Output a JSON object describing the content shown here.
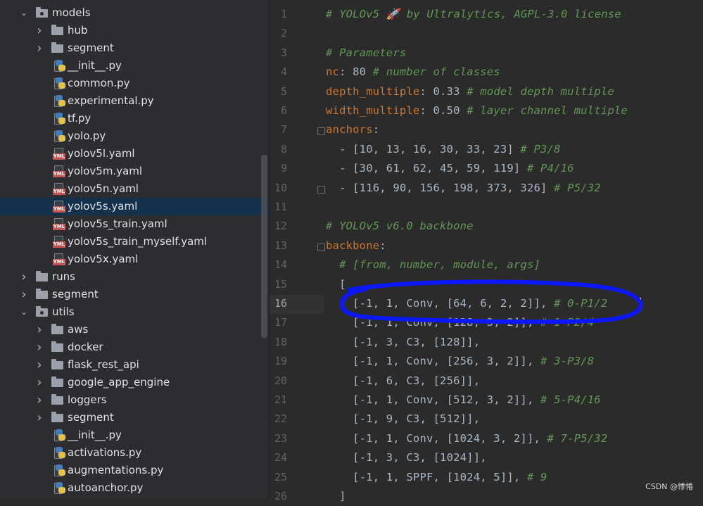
{
  "tree": {
    "items": [
      {
        "label": "models",
        "type": "folder-open",
        "indent": 0
      },
      {
        "label": "hub",
        "type": "folder",
        "indent": 1
      },
      {
        "label": "segment",
        "type": "folder",
        "indent": 1
      },
      {
        "label": "__init__.py",
        "type": "py",
        "indent": 1
      },
      {
        "label": "common.py",
        "type": "py",
        "indent": 1
      },
      {
        "label": "experimental.py",
        "type": "py",
        "indent": 1
      },
      {
        "label": "tf.py",
        "type": "py",
        "indent": 1
      },
      {
        "label": "yolo.py",
        "type": "py",
        "indent": 1
      },
      {
        "label": "yolov5l.yaml",
        "type": "yml",
        "indent": 1
      },
      {
        "label": "yolov5m.yaml",
        "type": "yml",
        "indent": 1
      },
      {
        "label": "yolov5n.yaml",
        "type": "yml",
        "indent": 1
      },
      {
        "label": "yolov5s.yaml",
        "type": "yml",
        "indent": 1,
        "selected": true
      },
      {
        "label": "yolov5s_train.yaml",
        "type": "yml",
        "indent": 1
      },
      {
        "label": "yolov5s_train_myself.yaml",
        "type": "yml",
        "indent": 1
      },
      {
        "label": "yolov5x.yaml",
        "type": "yml",
        "indent": 1
      },
      {
        "label": "runs",
        "type": "folder",
        "indent": 0
      },
      {
        "label": "segment",
        "type": "folder",
        "indent": 0
      },
      {
        "label": "utils",
        "type": "folder-open",
        "indent": 0
      },
      {
        "label": "aws",
        "type": "folder",
        "indent": 1
      },
      {
        "label": "docker",
        "type": "folder",
        "indent": 1
      },
      {
        "label": "flask_rest_api",
        "type": "folder",
        "indent": 1
      },
      {
        "label": "google_app_engine",
        "type": "folder",
        "indent": 1
      },
      {
        "label": "loggers",
        "type": "folder",
        "indent": 1
      },
      {
        "label": "segment",
        "type": "folder",
        "indent": 1
      },
      {
        "label": "__init__.py",
        "type": "py",
        "indent": 1
      },
      {
        "label": "activations.py",
        "type": "py",
        "indent": 1
      },
      {
        "label": "augmentations.py",
        "type": "py",
        "indent": 1
      },
      {
        "label": "autoanchor.py",
        "type": "py",
        "indent": 1
      }
    ]
  },
  "editor": {
    "current_line": 16,
    "lines": [
      {
        "n": "1",
        "parts": [
          {
            "t": "# YOLOv5 🚀 by Ultralytics, AGPL-3.0 license",
            "c": "cm"
          }
        ]
      },
      {
        "n": "2",
        "parts": []
      },
      {
        "n": "3",
        "parts": [
          {
            "t": "# Parameters",
            "c": "cm"
          }
        ]
      },
      {
        "n": "4",
        "parts": [
          {
            "t": "nc",
            "c": "ky"
          },
          {
            "t": ": 80 ",
            "c": ""
          },
          {
            "t": "# number of classes",
            "c": "cm"
          }
        ]
      },
      {
        "n": "5",
        "parts": [
          {
            "t": "depth_multiple",
            "c": "ky"
          },
          {
            "t": ": 0.33 ",
            "c": ""
          },
          {
            "t": "# model depth multiple",
            "c": "cm"
          }
        ]
      },
      {
        "n": "6",
        "parts": [
          {
            "t": "width_multiple",
            "c": "ky"
          },
          {
            "t": ": 0.50 ",
            "c": ""
          },
          {
            "t": "# layer channel multiple",
            "c": "cm"
          }
        ]
      },
      {
        "n": "7",
        "parts": [
          {
            "t": "anchors",
            "c": "ky"
          },
          {
            "t": ":",
            "c": ""
          }
        ]
      },
      {
        "n": "8",
        "parts": [
          {
            "t": "  - [10, 13, 16, 30, 33, 23] ",
            "c": ""
          },
          {
            "t": "# P3/8",
            "c": "cm"
          }
        ]
      },
      {
        "n": "9",
        "parts": [
          {
            "t": "  - [30, 61, 62, 45, 59, 119] ",
            "c": ""
          },
          {
            "t": "# P4/16",
            "c": "cm"
          }
        ]
      },
      {
        "n": "10",
        "parts": [
          {
            "t": "  - [116, 90, 156, 198, 373, 326] ",
            "c": ""
          },
          {
            "t": "# P5/32",
            "c": "cm"
          }
        ]
      },
      {
        "n": "11",
        "parts": []
      },
      {
        "n": "12",
        "parts": [
          {
            "t": "# YOLOv5 v6.0 backbone",
            "c": "cm"
          }
        ]
      },
      {
        "n": "13",
        "parts": [
          {
            "t": "backbone",
            "c": "ky"
          },
          {
            "t": ":",
            "c": ""
          }
        ]
      },
      {
        "n": "14",
        "parts": [
          {
            "t": "  ",
            "c": ""
          },
          {
            "t": "# [from, number, module, args]",
            "c": "cm"
          }
        ]
      },
      {
        "n": "15",
        "parts": [
          {
            "t": "  [",
            "c": ""
          }
        ]
      },
      {
        "n": "16",
        "parts": [
          {
            "t": "    [-1, 1, Conv, [64, 6, 2, 2]], ",
            "c": ""
          },
          {
            "t": "# 0-P1/2",
            "c": "cm"
          }
        ]
      },
      {
        "n": "17",
        "parts": [
          {
            "t": "    [-1, 1, Conv, [128, 3, 2]], ",
            "c": ""
          },
          {
            "t": "# 1-P2/4",
            "c": "cm"
          }
        ]
      },
      {
        "n": "18",
        "parts": [
          {
            "t": "    [-1, 3, C3, [128]],",
            "c": ""
          }
        ]
      },
      {
        "n": "19",
        "parts": [
          {
            "t": "    [-1, 1, Conv, [256, 3, 2]], ",
            "c": ""
          },
          {
            "t": "# 3-P3/8",
            "c": "cm"
          }
        ]
      },
      {
        "n": "20",
        "parts": [
          {
            "t": "    [-1, 6, C3, [256]],",
            "c": ""
          }
        ]
      },
      {
        "n": "21",
        "parts": [
          {
            "t": "    [-1, 1, Conv, [512, 3, 2]], ",
            "c": ""
          },
          {
            "t": "# 5-P4/16",
            "c": "cm"
          }
        ]
      },
      {
        "n": "22",
        "parts": [
          {
            "t": "    [-1, 9, C3, [512]],",
            "c": ""
          }
        ]
      },
      {
        "n": "23",
        "parts": [
          {
            "t": "    [-1, 1, Conv, [1024, 3, 2]], ",
            "c": ""
          },
          {
            "t": "# 7-P5/32",
            "c": "cm"
          }
        ]
      },
      {
        "n": "24",
        "parts": [
          {
            "t": "    [-1, 3, C3, [1024]],",
            "c": ""
          }
        ]
      },
      {
        "n": "25",
        "parts": [
          {
            "t": "    [-1, 1, SPPF, [1024, 5]], ",
            "c": ""
          },
          {
            "t": "# 9",
            "c": "cm"
          }
        ]
      },
      {
        "n": "26",
        "parts": [
          {
            "t": "  ]",
            "c": ""
          }
        ]
      }
    ]
  },
  "watermark": "CSDN @悸惓",
  "colors": {
    "annotation": "#0a17ff",
    "comment": "#629755",
    "key": "#cc7832"
  }
}
